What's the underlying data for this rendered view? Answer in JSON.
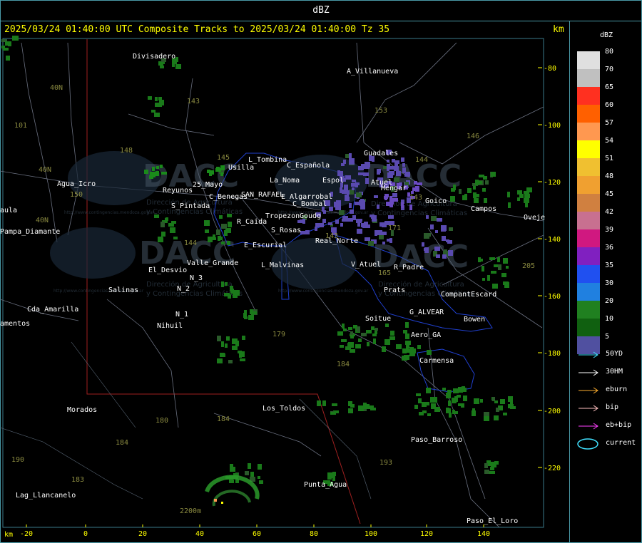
{
  "header": {
    "title": "dBZ"
  },
  "plot": {
    "title": "2025/03/24 01:40:00 UTC Composite Tracks to 2025/03/24 01:40:00 Tz 35",
    "unit_top": "km",
    "unit_bottom": "km",
    "x_ticks": [
      "-20",
      "0",
      "20",
      "40",
      "60",
      "80",
      "100",
      "120",
      "140"
    ],
    "y_ticks": [
      "-80",
      "-100",
      "-120",
      "-140",
      "-160",
      "-180",
      "-200",
      "-220"
    ]
  },
  "legend": {
    "title": "dBZ",
    "scale": [
      {
        "value": "80",
        "color": "#e0e0e0"
      },
      {
        "value": "70",
        "color": "#c0c0c0"
      },
      {
        "value": "65",
        "color": "#ff3020"
      },
      {
        "value": "60",
        "color": "#ff6000"
      },
      {
        "value": "57",
        "color": "#ff9850"
      },
      {
        "value": "54",
        "color": "#ffff00"
      },
      {
        "value": "51",
        "color": "#f0c030"
      },
      {
        "value": "48",
        "color": "#f0a030"
      },
      {
        "value": "45",
        "color": "#d08040"
      },
      {
        "value": "42",
        "color": "#c87090"
      },
      {
        "value": "39",
        "color": "#d01880"
      },
      {
        "value": "36",
        "color": "#8020c0"
      },
      {
        "value": "35",
        "color": "#2050f0"
      },
      {
        "value": "30",
        "color": "#2080e0"
      },
      {
        "value": "20",
        "color": "#208020"
      },
      {
        "value": "10",
        "color": "#106010"
      },
      {
        "value": "5",
        "color": "#5050a0"
      }
    ],
    "tracks": [
      {
        "label": "50YD",
        "color": "#40e0ff"
      },
      {
        "label": "30HM",
        "color": "#ffffff"
      },
      {
        "label": "eburn",
        "color": "#ffb030"
      },
      {
        "label": "bip",
        "color": "#ffc0c0"
      },
      {
        "label": "eb+bip",
        "color": "#ff40ff"
      },
      {
        "label": "current",
        "color": "#40e0ff"
      }
    ]
  },
  "watermark": {
    "brand": "DACC",
    "line1": "Dirección de Agricultura",
    "line2": "y Contingencias Climáticas",
    "url": "http://www.contingencias.mendoza.gov.ar"
  },
  "places": [
    {
      "name": "Divisadero"
    },
    {
      "name": "A_Villanueva"
    },
    {
      "name": "Guadales"
    },
    {
      "name": "L_Tombina"
    },
    {
      "name": "Usilla"
    },
    {
      "name": "C_Española"
    },
    {
      "name": "La_Noma"
    },
    {
      "name": "Agua_Icro"
    },
    {
      "name": "Reyunos"
    },
    {
      "name": "25_Mayo"
    },
    {
      "name": "C_Benegas"
    },
    {
      "name": "SAN_RAFAEL"
    },
    {
      "name": "E_Algarrobal"
    },
    {
      "name": "C_Bombal"
    },
    {
      "name": "Tropezon"
    },
    {
      "name": "Goudg"
    },
    {
      "name": "S_Pintada"
    },
    {
      "name": "R_Caida"
    },
    {
      "name": "S_Rosas"
    },
    {
      "name": "Real_Norte"
    },
    {
      "name": "E_Escurial"
    },
    {
      "name": "L_Malvinas"
    },
    {
      "name": "Valle_Grande"
    },
    {
      "name": "El_Desvio"
    },
    {
      "name": "Salinas"
    },
    {
      "name": "V_Atuel"
    },
    {
      "name": "R_Padre"
    },
    {
      "name": "Prats"
    },
    {
      "name": "CompantEscard"
    },
    {
      "name": "G_ALVEAR"
    },
    {
      "name": "Soitue"
    },
    {
      "name": "Bowen"
    },
    {
      "name": "Aero_GA"
    },
    {
      "name": "Carmensa"
    },
    {
      "name": "Los_Toldos"
    },
    {
      "name": "Morados"
    },
    {
      "name": "Paso_Barroso"
    },
    {
      "name": "Punta_Agua"
    },
    {
      "name": "Lag_Llancanelo"
    },
    {
      "name": "Paso_El_Loro"
    },
    {
      "name": "Goico"
    },
    {
      "name": "Campos"
    },
    {
      "name": "Oveje"
    },
    {
      "name": "Nihuil"
    },
    {
      "name": "N_1"
    },
    {
      "name": "N_2"
    },
    {
      "name": "N_3"
    },
    {
      "name": "Pampa_Diamante"
    },
    {
      "name": "Cda_Amarilla"
    },
    {
      "name": "amentos"
    },
    {
      "name": "aula"
    },
    {
      "name": "Espol"
    },
    {
      "name": "Atuel"
    },
    {
      "name": "Mengar"
    }
  ],
  "routes": [
    "143",
    "153",
    "146",
    "148",
    "101",
    "40N",
    "40N",
    "40N",
    "145",
    "150",
    "143",
    "144",
    "179",
    "184",
    "180",
    "184",
    "184",
    "183",
    "190",
    "193",
    "143",
    "171",
    "205",
    "144",
    "165"
  ],
  "radar": {
    "range_label": "2200m"
  }
}
